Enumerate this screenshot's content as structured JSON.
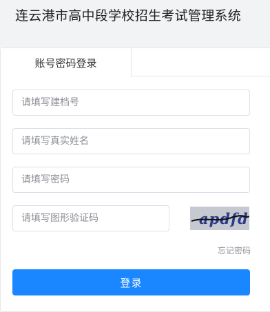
{
  "header": {
    "title": "连云港市高中段学校招生考试管理系统"
  },
  "tabs": [
    {
      "label": "账号密码登录",
      "active": true
    }
  ],
  "form": {
    "archive_number": {
      "placeholder": "请填写建档号",
      "value": ""
    },
    "real_name": {
      "placeholder": "请填写真实姓名",
      "value": ""
    },
    "password": {
      "placeholder": "请填写密码",
      "value": ""
    },
    "captcha": {
      "placeholder": "请填写图形验证码",
      "value": "",
      "image_text": "apdfd"
    },
    "forgot_password": "忘记密码",
    "login_label": "登录"
  },
  "colors": {
    "primary": "#1a86ff",
    "background": "#f2f3f5",
    "border": "#dcdfe6"
  }
}
